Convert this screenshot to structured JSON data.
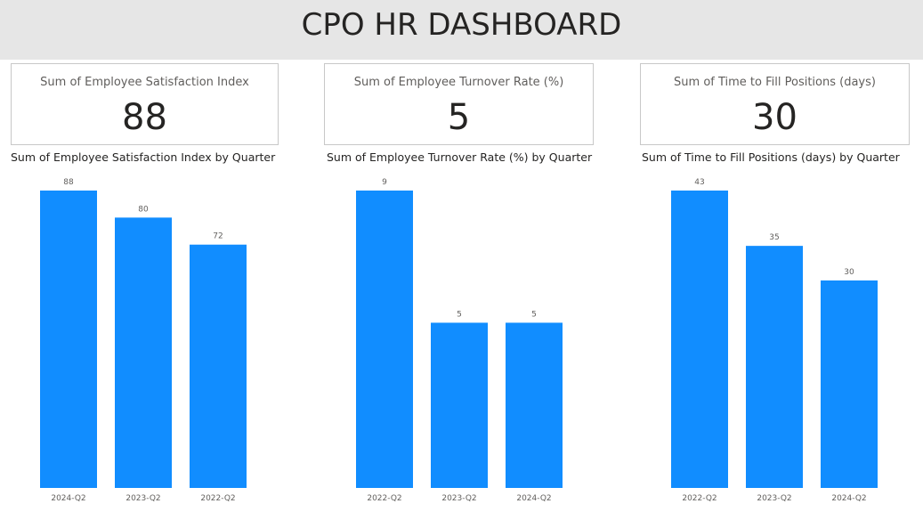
{
  "header": {
    "title": "CPO HR DASHBOARD"
  },
  "kpis": [
    {
      "label": "Sum of Employee Satisfaction Index",
      "value": "88"
    },
    {
      "label": "Sum of Employee Turnover Rate (%)",
      "value": "5"
    },
    {
      "label": "Sum of Time to Fill Positions (days)",
      "value": "30"
    }
  ],
  "colors": {
    "bar": "#118dff",
    "header_bg": "#e6e6e6",
    "text": "#252423",
    "label": "#605e5c"
  },
  "chart_data": [
    {
      "type": "bar",
      "title": "Sum of Employee Satisfaction Index by Quarter",
      "categories": [
        "2024-Q2",
        "2023-Q2",
        "2022-Q2"
      ],
      "values": [
        88,
        80,
        72
      ],
      "data_labels": [
        "88",
        "80",
        "72"
      ],
      "ylim": [
        0,
        88
      ],
      "grid": false,
      "xlabel": "",
      "ylabel": ""
    },
    {
      "type": "bar",
      "title": "Sum of Employee Turnover Rate (%) by Quarter",
      "categories": [
        "2022-Q2",
        "2023-Q2",
        "2024-Q2"
      ],
      "values": [
        9,
        5,
        5
      ],
      "data_labels": [
        "9",
        "5",
        "5"
      ],
      "ylim": [
        0,
        9
      ],
      "grid": false,
      "xlabel": "",
      "ylabel": ""
    },
    {
      "type": "bar",
      "title": "Sum of Time to Fill Positions (days) by Quarter",
      "categories": [
        "2022-Q2",
        "2023-Q2",
        "2024-Q2"
      ],
      "values": [
        43,
        35,
        30
      ],
      "data_labels": [
        "43",
        "35",
        "30"
      ],
      "ylim": [
        0,
        43
      ],
      "grid": false,
      "xlabel": "",
      "ylabel": ""
    }
  ]
}
